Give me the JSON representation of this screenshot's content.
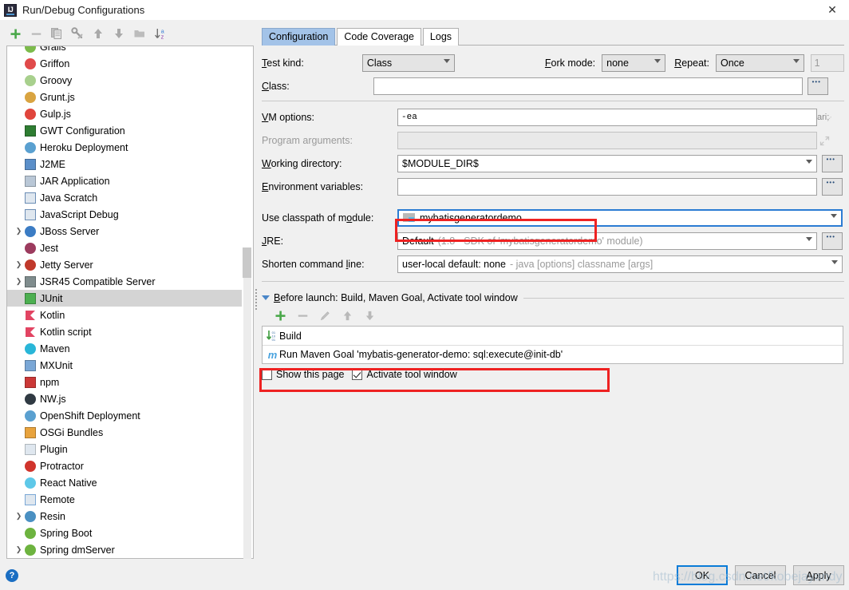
{
  "window": {
    "title": "Run/Debug Configurations",
    "app_icon": "intellij-idea-icon",
    "close_label": "✕"
  },
  "toolbar": {
    "items": [
      {
        "name": "add-configuration-button",
        "glyph": "+",
        "title": "Add New Configuration"
      },
      {
        "name": "remove-configuration-button",
        "glyph": "−",
        "title": "Remove Configuration"
      },
      {
        "name": "copy-configuration-button",
        "glyph": "copy-icon",
        "title": "Copy Configuration"
      },
      {
        "name": "edit-templates-button",
        "glyph": "wrench-icon",
        "title": "Edit Templates"
      },
      {
        "name": "move-up-button",
        "glyph": "arrow-up-icon",
        "title": "Move Up"
      },
      {
        "name": "move-down-button",
        "glyph": "arrow-down-icon",
        "title": "Move Down"
      },
      {
        "name": "create-folder-button",
        "glyph": "folder-icon",
        "title": "Create New Folder"
      },
      {
        "name": "sort-configurations-button",
        "glyph": "sort-az-icon",
        "title": "Sort Configurations"
      }
    ]
  },
  "tree": {
    "items": [
      {
        "label": "Grails",
        "icon": "grails-icon",
        "color": "#7cbb4b",
        "expandable": false,
        "selected": false,
        "partial": true
      },
      {
        "label": "Griffon",
        "icon": "griffon-icon",
        "color": "#e04a4a",
        "expandable": false,
        "selected": false
      },
      {
        "label": "Groovy",
        "icon": "groovy-icon",
        "color": "#a8d08d",
        "expandable": false,
        "selected": false
      },
      {
        "label": "Grunt.js",
        "icon": "grunt-icon",
        "color": "#d9a441",
        "expandable": false,
        "selected": false
      },
      {
        "label": "Gulp.js",
        "icon": "gulp-icon",
        "color": "#e0453c",
        "expandable": false,
        "selected": false
      },
      {
        "label": "GWT Configuration",
        "icon": "gwt-icon",
        "color": "#2e7d32",
        "expandable": false,
        "selected": false
      },
      {
        "label": "Heroku Deployment",
        "icon": "heroku-icon",
        "color": "#5aa0d0",
        "expandable": false,
        "selected": false
      },
      {
        "label": "J2ME",
        "icon": "j2me-icon",
        "color": "#5b8fc9",
        "expandable": false,
        "selected": false
      },
      {
        "label": "JAR Application",
        "icon": "jar-icon",
        "color": "#b9c7d6",
        "expandable": false,
        "selected": false
      },
      {
        "label": "Java Scratch",
        "icon": "java-scratch-icon",
        "color": "#6b8db5",
        "expandable": false,
        "selected": false
      },
      {
        "label": "JavaScript Debug",
        "icon": "javascript-debug-icon",
        "color": "#6b8db5",
        "expandable": false,
        "selected": false
      },
      {
        "label": "JBoss Server",
        "icon": "jboss-icon",
        "color": "#3b7cc4",
        "expandable": true,
        "selected": false
      },
      {
        "label": "Jest",
        "icon": "jest-icon",
        "color": "#9c3b5e",
        "expandable": false,
        "selected": false
      },
      {
        "label": "Jetty Server",
        "icon": "jetty-icon",
        "color": "#c0392b",
        "expandable": true,
        "selected": false
      },
      {
        "label": "JSR45 Compatible Server",
        "icon": "jsr45-icon",
        "color": "#7f8c8d",
        "expandable": true,
        "selected": false
      },
      {
        "label": "JUnit",
        "icon": "junit-icon",
        "color": "#4caf50",
        "expandable": false,
        "selected": true
      },
      {
        "label": "Kotlin",
        "icon": "kotlin-icon",
        "color": "#e24462",
        "expandable": false,
        "selected": false
      },
      {
        "label": "Kotlin script",
        "icon": "kotlin-script-icon",
        "color": "#e24462",
        "expandable": false,
        "selected": false
      },
      {
        "label": "Maven",
        "icon": "maven-icon",
        "color": "#29b6d8",
        "expandable": false,
        "selected": false
      },
      {
        "label": "MXUnit",
        "icon": "mxunit-icon",
        "color": "#7aa7d6",
        "expandable": false,
        "selected": false
      },
      {
        "label": "npm",
        "icon": "npm-icon",
        "color": "#cb3837",
        "expandable": false,
        "selected": false
      },
      {
        "label": "NW.js",
        "icon": "nwjs-icon",
        "color": "#303a43",
        "expandable": false,
        "selected": false
      },
      {
        "label": "OpenShift Deployment",
        "icon": "openshift-icon",
        "color": "#5aa0d0",
        "expandable": false,
        "selected": false
      },
      {
        "label": "OSGi Bundles",
        "icon": "osgi-icon",
        "color": "#e8a33d",
        "expandable": false,
        "selected": false
      },
      {
        "label": "Plugin",
        "icon": "plugin-icon",
        "color": "#b0b7bd",
        "expandable": false,
        "selected": false
      },
      {
        "label": "Protractor",
        "icon": "protractor-icon",
        "color": "#d0342c",
        "expandable": false,
        "selected": false
      },
      {
        "label": "React Native",
        "icon": "react-native-icon",
        "color": "#5ec8e8",
        "expandable": false,
        "selected": false
      },
      {
        "label": "Remote",
        "icon": "remote-icon",
        "color": "#7aa7d6",
        "expandable": false,
        "selected": false
      },
      {
        "label": "Resin",
        "icon": "resin-icon",
        "color": "#4a90c2",
        "expandable": true,
        "selected": false
      },
      {
        "label": "Spring Boot",
        "icon": "spring-boot-icon",
        "color": "#6db33f",
        "expandable": false,
        "selected": false
      },
      {
        "label": "Spring dmServer",
        "icon": "spring-dmserver-icon",
        "color": "#6db33f",
        "expandable": true,
        "selected": false
      }
    ]
  },
  "tabs": [
    {
      "label": "Configuration",
      "active": true
    },
    {
      "label": "Code Coverage",
      "active": false
    },
    {
      "label": "Logs",
      "active": false
    }
  ],
  "form": {
    "test_kind_label": "Test kind:",
    "test_kind_value": "Class",
    "fork_mode_label": "Fork mode:",
    "fork_mode_value": "none",
    "repeat_label": "Repeat:",
    "repeat_value": "Once",
    "repeat_count_value": "1",
    "class_label": "Class:",
    "class_value": "",
    "vm_options_label": "VM options:",
    "vm_options_value": "-ea",
    "program_arguments_label": "Program arguments:",
    "program_arguments_value": "",
    "working_directory_label": "Working directory:",
    "working_directory_value": "$MODULE_DIR$",
    "environment_variables_label": "Environment variables:",
    "environment_variables_value": "",
    "use_classpath_label": "Use classpath of module:",
    "use_classpath_value": "mybatisgeneratordemo",
    "jre_label": "JRE:",
    "jre_value": "Default",
    "jre_hint": "(1.8 - SDK of 'mybatisgeneratordemo' module)",
    "shorten_command_line_label": "Shorten command line:",
    "shorten_command_line_value": "user-local default: none",
    "shorten_command_line_hint": "- java [options] classname [args]",
    "browse_label": "•••"
  },
  "before_launch": {
    "title": "Before launch: Build, Maven Goal, Activate tool window",
    "toolbar": [
      {
        "name": "before-launch-add-button",
        "glyph": "+"
      },
      {
        "name": "before-launch-remove-button",
        "glyph": "−"
      },
      {
        "name": "before-launch-edit-button",
        "glyph": "pencil-icon"
      },
      {
        "name": "before-launch-move-up-button",
        "glyph": "arrow-up-icon"
      },
      {
        "name": "before-launch-move-down-button",
        "glyph": "arrow-down-icon"
      }
    ],
    "rows": [
      {
        "label": "Build",
        "icon": "build-icon"
      },
      {
        "label": "Run Maven Goal 'mybatis-generator-demo: sql:execute@init-db'",
        "icon": "maven-goal-icon"
      }
    ],
    "show_page_label": "Show this page",
    "show_page_checked": false,
    "activate_tool_window_label": "Activate tool window",
    "activate_tool_window_checked": true
  },
  "footer": {
    "help_label": "?",
    "ok_label": "OK",
    "cancel_label": "Cancel",
    "apply_label": "Apply",
    "watermark": "https://blog.csdn.net/kobejayandy"
  },
  "colors": {
    "accent": "#2b7cd3",
    "annotation_red": "#ee2222",
    "tab_active": "#a3c3e8",
    "selection": "#d4d4d4"
  }
}
